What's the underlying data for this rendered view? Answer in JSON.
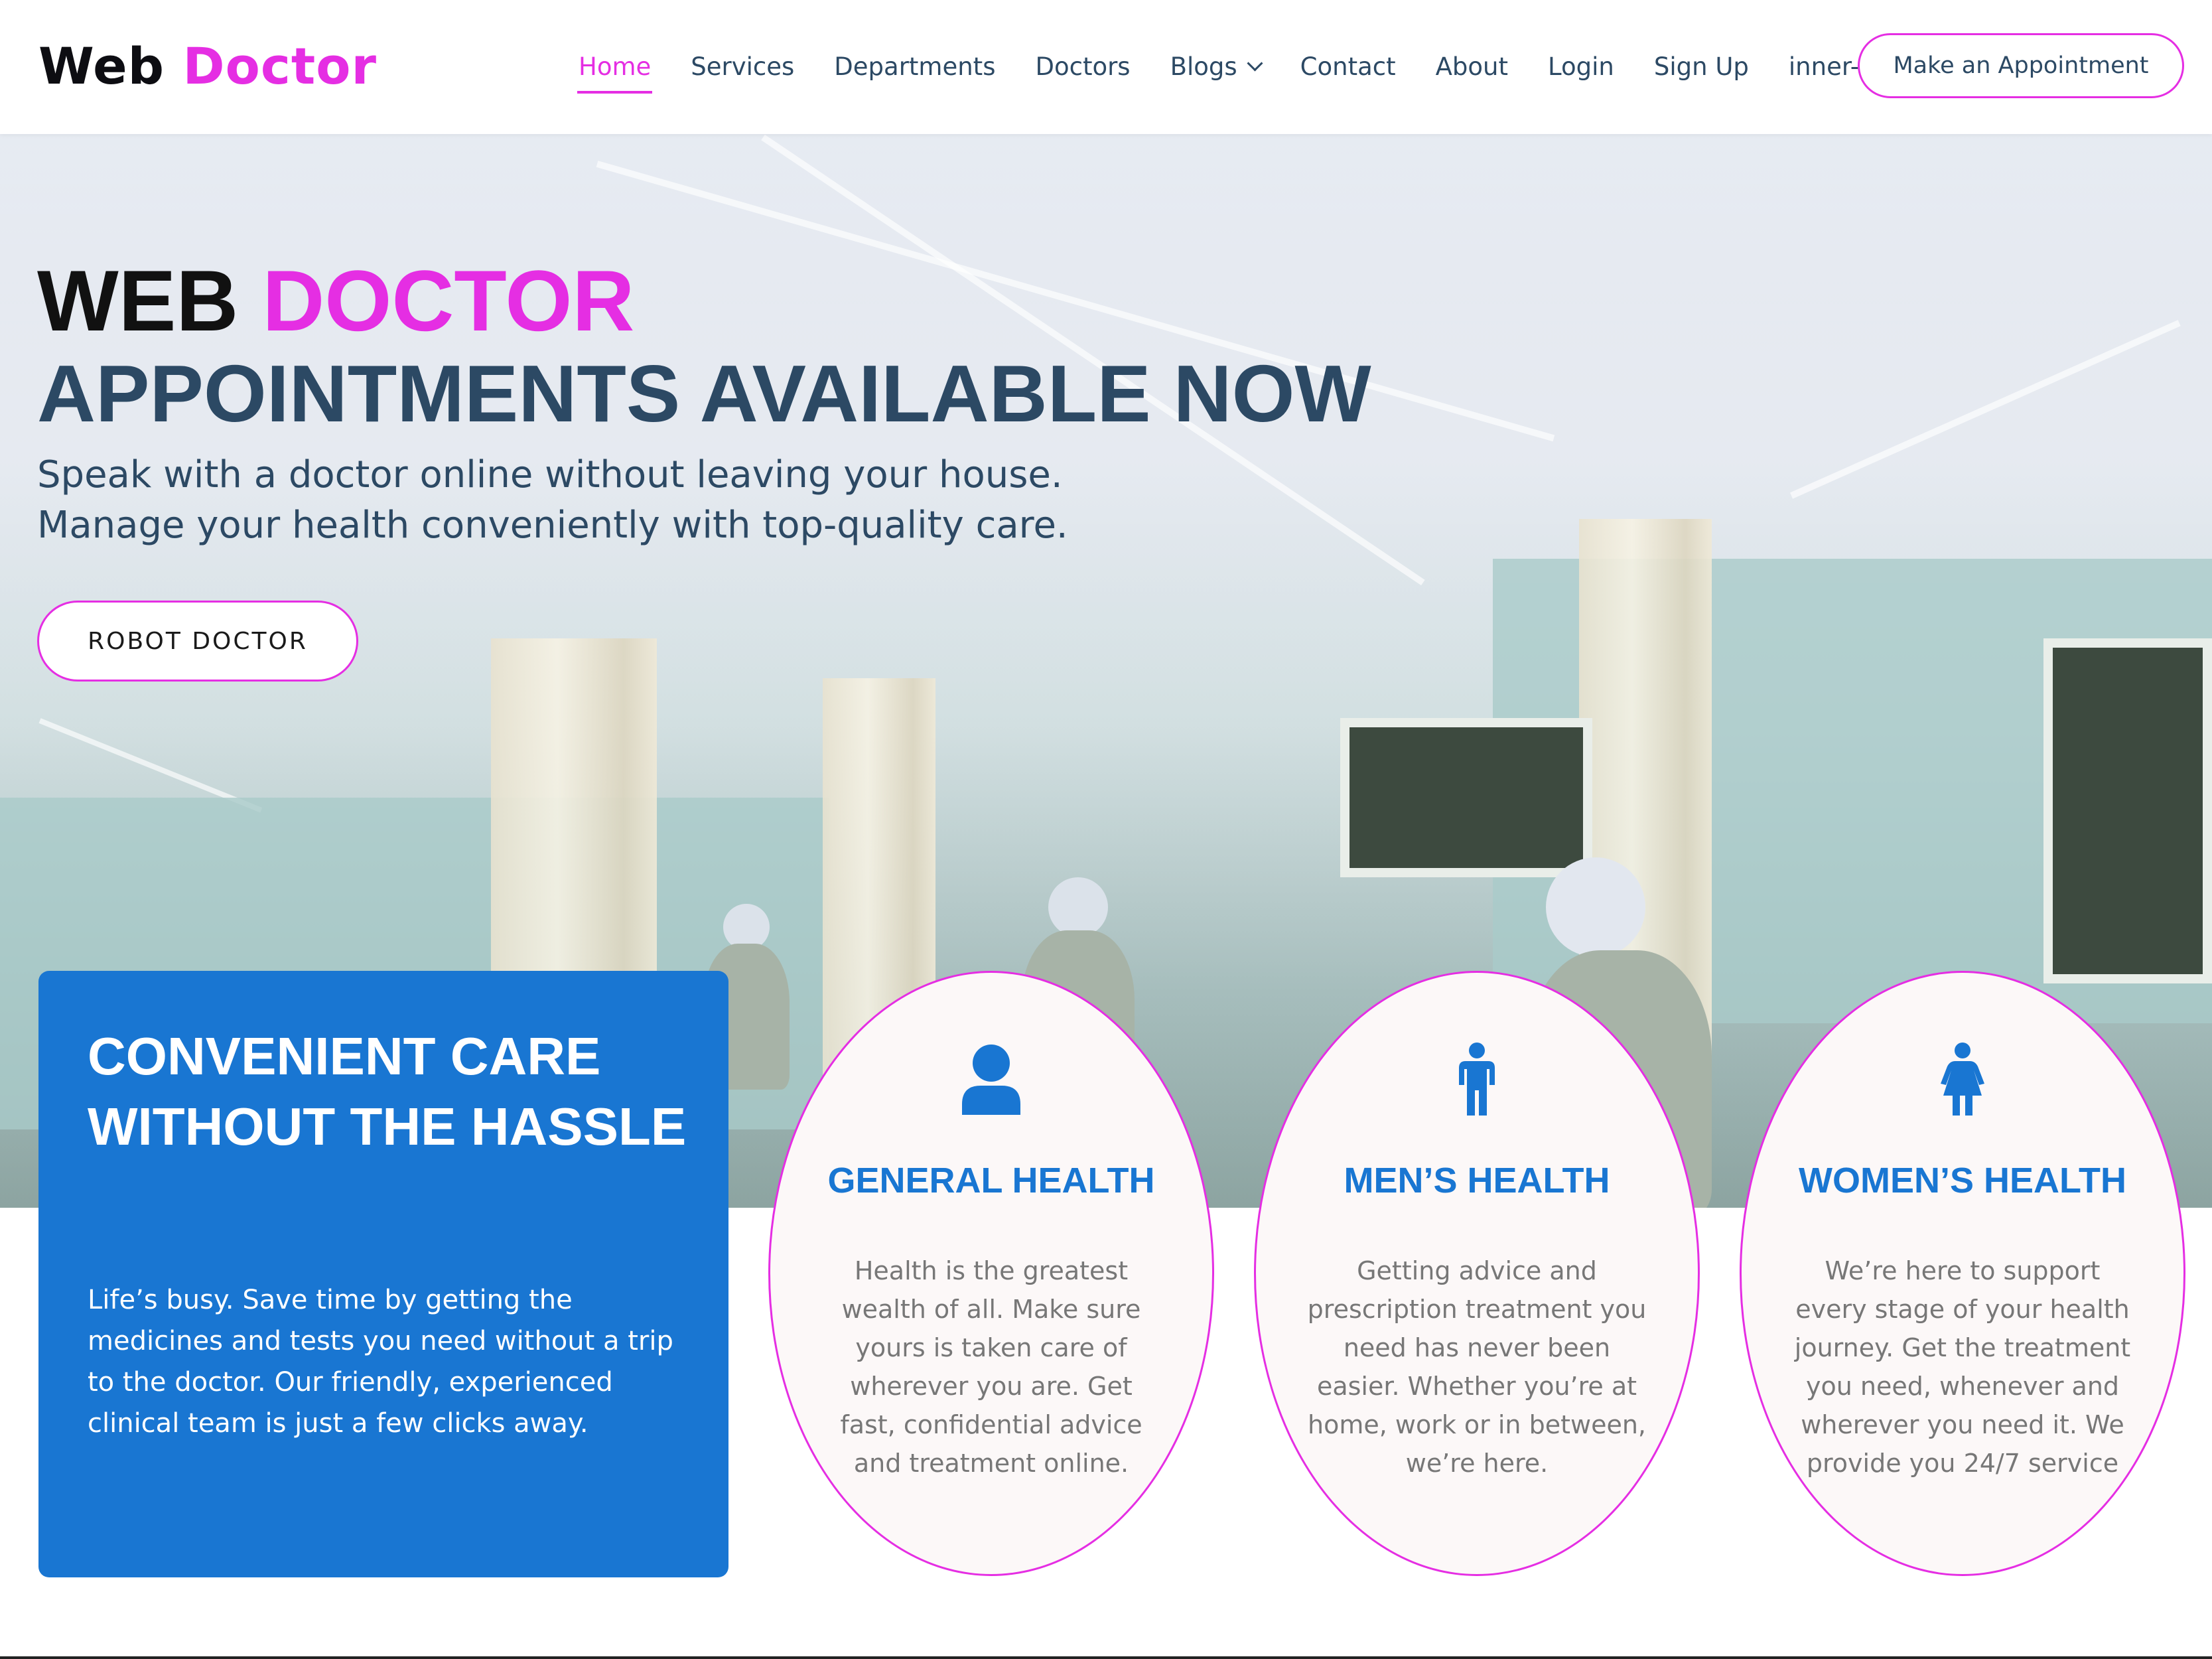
{
  "brand": {
    "part1": "Web",
    "part2": "Doctor",
    "primary_color": "#e52ee3",
    "dark_color": "#0d0d12"
  },
  "nav": {
    "items": [
      {
        "label": "Home",
        "active": true
      },
      {
        "label": "Services"
      },
      {
        "label": "Departments"
      },
      {
        "label": "Doctors"
      },
      {
        "label": "Blogs",
        "has_dropdown": true
      },
      {
        "label": "Contact"
      },
      {
        "label": "About"
      },
      {
        "label": "Login"
      },
      {
        "label": "Sign Up"
      },
      {
        "label": "inner-page"
      }
    ],
    "cta_label": "Make an Appointment"
  },
  "hero": {
    "title_part1": "WEB",
    "title_part2": "DOCTOR",
    "title_line2": "APPOINTMENTS AVAILABLE NOW",
    "subtitle_line1": "Speak with a doctor online without leaving your house.",
    "subtitle_line2": "Manage your health conveniently with top-quality care.",
    "button_label": "ROBOT DOCTOR",
    "text_color": "#2c4964"
  },
  "care_card": {
    "title": "CONVENIENT CARE WITHOUT THE HASSLE",
    "text": "Life’s busy. Save time by getting the medicines and tests you need without a trip to the doctor. Our friendly, experienced clinical team is just a few clicks away.",
    "background": "#1976d2"
  },
  "services": [
    {
      "icon": "person-icon",
      "title": "GENERAL HEALTH",
      "text": "Health is the greatest wealth of all. Make sure yours is taken care of wherever you are. Get fast, confidential advice and treatment online."
    },
    {
      "icon": "male-icon",
      "title": "MEN’S HEALTH",
      "text": "Getting advice and prescription treatment you need has never been easier. Whether you’re at home, work or in between, we’re here."
    },
    {
      "icon": "female-icon",
      "title": "WOMEN’S HEALTH",
      "text": "We’re here to support every stage of your health journey. Get the treatment you need, whenever and wherever you need it. We provide you 24/7 service"
    }
  ]
}
